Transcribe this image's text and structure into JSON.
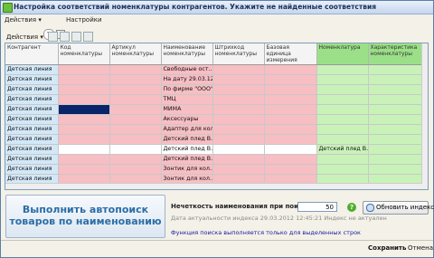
{
  "window": {
    "title": "Настройка соответствий номенклатуры контрагентов. Укажите не найденные соответствия"
  },
  "toolbar": {
    "actions_label": "Действия",
    "help_label": "?",
    "settings_label": "Настройки"
  },
  "grid_toolbar": {
    "actions_label": "Действия"
  },
  "table": {
    "columns": [
      "Контрагент",
      "Код номенклатуры",
      "Артикул номенклатуры",
      "Наименование номенклатуры",
      "Штрихкод номенклатуры",
      "Базовая единица измерения",
      "Номенклатура",
      "Характеристика номенклатуры"
    ],
    "rows": [
      {
        "counterparty": "Детская линия",
        "name": "Свободные ост…",
        "nom": ""
      },
      {
        "counterparty": "Детская линия",
        "name": "На дату 29.03.12",
        "nom": ""
      },
      {
        "counterparty": "Детская линия",
        "name": "По фирме \"ООО\"",
        "nom": ""
      },
      {
        "counterparty": "Детская линия",
        "name": "ТМЦ",
        "nom": ""
      },
      {
        "counterparty": "Детская линия",
        "name": "МИМА",
        "nom": ""
      },
      {
        "counterparty": "Детская линия",
        "name": "Аксессуары",
        "nom": ""
      },
      {
        "counterparty": "Детская линия",
        "name": "Адаптер для кол…",
        "nom": ""
      },
      {
        "counterparty": "Детская линия",
        "name": "Детский плед В…",
        "nom": ""
      },
      {
        "counterparty": "Детская линия",
        "name": "Детский плед В…",
        "nom": "Детский плед В…"
      },
      {
        "counterparty": "Детская линия",
        "name": "Детский плед В…",
        "nom": ""
      },
      {
        "counterparty": "Детская линия",
        "name": "Зонтик для кол…",
        "nom": ""
      },
      {
        "counterparty": "Детская линия",
        "name": "Зонтик для кол…",
        "nom": ""
      },
      {
        "counterparty": "Детская линия",
        "name": "Зонтик для кол…",
        "nom": ""
      },
      {
        "counterparty": "Детская линия",
        "name": "Зонтик для кол…",
        "nom": ""
      }
    ]
  },
  "autosearch": {
    "label": "Выполнить автопоиск товаров по наименованию"
  },
  "precision": {
    "label": "Нечеткость наименования при поиске (%):",
    "value": "50"
  },
  "reindex": {
    "label": "Обновить индекс"
  },
  "index_info": "Дата актуальности индекса 29.03.2012 12:45:21 Индекс не актуален",
  "note": "Функция поиска выполняется только для выделенных строк",
  "footer": {
    "save_label": "Сохранить",
    "cancel_label": "Отмена"
  },
  "colors": {
    "pink": "#f7bec4",
    "green": "#c9f2b9",
    "light_blue": "#d2e8f8",
    "selection": "#0a246a"
  }
}
